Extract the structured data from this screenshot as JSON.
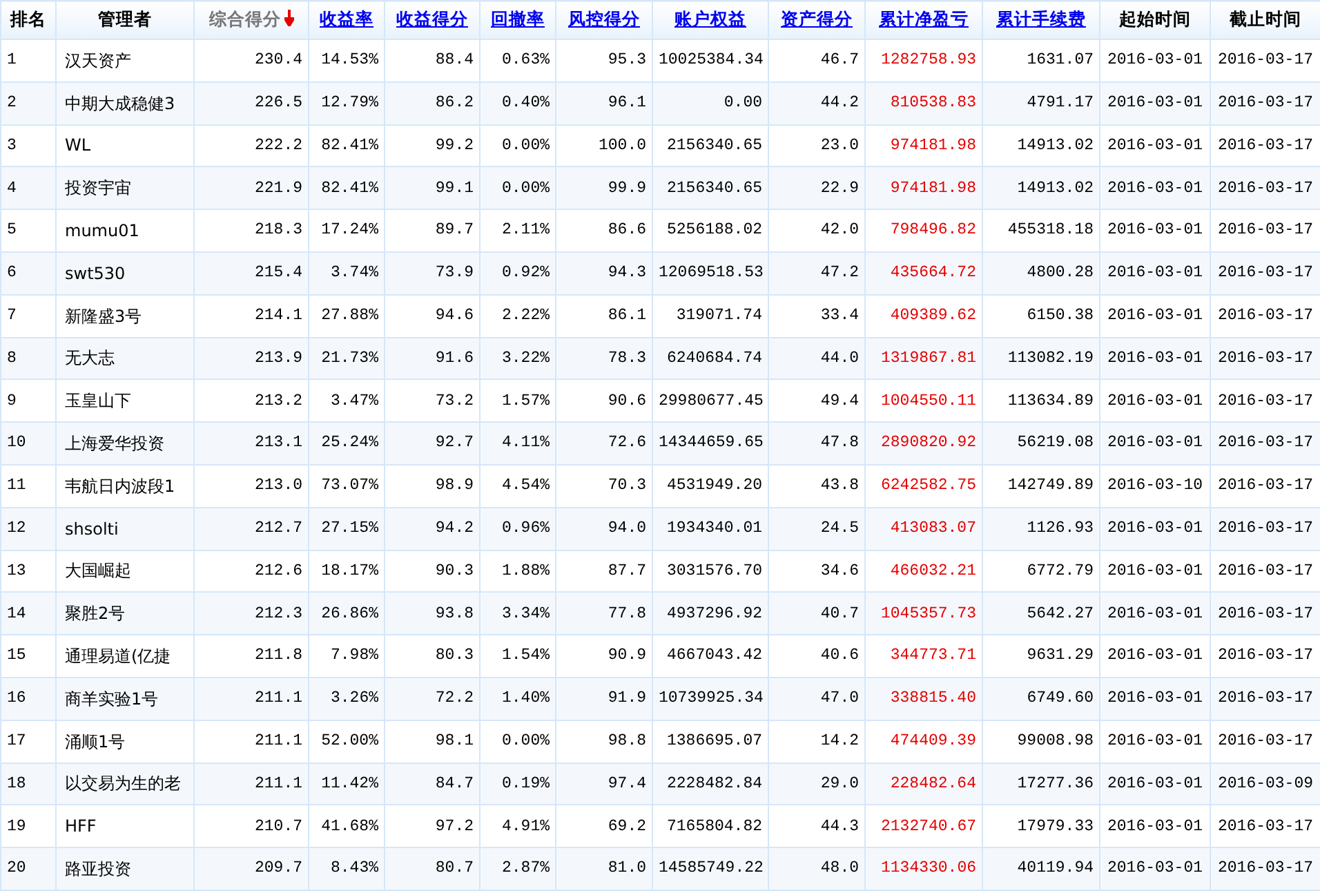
{
  "table": {
    "columns": [
      {
        "label": "排名",
        "kind": "rank",
        "link": false,
        "selected": false
      },
      {
        "label": "管理者",
        "kind": "name",
        "link": false,
        "selected": false
      },
      {
        "label": "综合得分",
        "kind": "number",
        "link": true,
        "selected": true
      },
      {
        "label": "收益率",
        "kind": "number",
        "link": true,
        "selected": false
      },
      {
        "label": "收益得分",
        "kind": "number",
        "link": true,
        "selected": false
      },
      {
        "label": "回撤率",
        "kind": "number",
        "link": true,
        "selected": false
      },
      {
        "label": "风控得分",
        "kind": "number",
        "link": true,
        "selected": false
      },
      {
        "label": "账户权益",
        "kind": "number",
        "link": true,
        "selected": false
      },
      {
        "label": "资产得分",
        "kind": "number",
        "link": true,
        "selected": false
      },
      {
        "label": "累计净盈亏",
        "kind": "profit",
        "link": true,
        "selected": false
      },
      {
        "label": "累计手续费",
        "kind": "number",
        "link": true,
        "selected": false
      },
      {
        "label": "起始时间",
        "kind": "date",
        "link": false,
        "selected": false
      },
      {
        "label": "截止时间",
        "kind": "date",
        "link": false,
        "selected": false
      }
    ],
    "rows": [
      [
        "1",
        "汉天资产",
        "230.4",
        "14.53%",
        "88.4",
        "0.63%",
        "95.3",
        "10025384.34",
        "46.7",
        "1282758.93",
        "1631.07",
        "2016-03-01",
        "2016-03-17"
      ],
      [
        "2",
        "中期大成稳健3",
        "226.5",
        "12.79%",
        "86.2",
        "0.40%",
        "96.1",
        "0.00",
        "44.2",
        "810538.83",
        "4791.17",
        "2016-03-01",
        "2016-03-17"
      ],
      [
        "3",
        "WL",
        "222.2",
        "82.41%",
        "99.2",
        "0.00%",
        "100.0",
        "2156340.65",
        "23.0",
        "974181.98",
        "14913.02",
        "2016-03-01",
        "2016-03-17"
      ],
      [
        "4",
        "投资宇宙",
        "221.9",
        "82.41%",
        "99.1",
        "0.00%",
        "99.9",
        "2156340.65",
        "22.9",
        "974181.98",
        "14913.02",
        "2016-03-01",
        "2016-03-17"
      ],
      [
        "5",
        "mumu01",
        "218.3",
        "17.24%",
        "89.7",
        "2.11%",
        "86.6",
        "5256188.02",
        "42.0",
        "798496.82",
        "455318.18",
        "2016-03-01",
        "2016-03-17"
      ],
      [
        "6",
        "swt530",
        "215.4",
        "3.74%",
        "73.9",
        "0.92%",
        "94.3",
        "12069518.53",
        "47.2",
        "435664.72",
        "4800.28",
        "2016-03-01",
        "2016-03-17"
      ],
      [
        "7",
        "新隆盛3号",
        "214.1",
        "27.88%",
        "94.6",
        "2.22%",
        "86.1",
        "319071.74",
        "33.4",
        "409389.62",
        "6150.38",
        "2016-03-01",
        "2016-03-17"
      ],
      [
        "8",
        "无大志",
        "213.9",
        "21.73%",
        "91.6",
        "3.22%",
        "78.3",
        "6240684.74",
        "44.0",
        "1319867.81",
        "113082.19",
        "2016-03-01",
        "2016-03-17"
      ],
      [
        "9",
        "玉皇山下",
        "213.2",
        "3.47%",
        "73.2",
        "1.57%",
        "90.6",
        "29980677.45",
        "49.4",
        "1004550.11",
        "113634.89",
        "2016-03-01",
        "2016-03-17"
      ],
      [
        "10",
        "上海爱华投资",
        "213.1",
        "25.24%",
        "92.7",
        "4.11%",
        "72.6",
        "14344659.65",
        "47.8",
        "2890820.92",
        "56219.08",
        "2016-03-01",
        "2016-03-17"
      ],
      [
        "11",
        "韦航日内波段1",
        "213.0",
        "73.07%",
        "98.9",
        "4.54%",
        "70.3",
        "4531949.20",
        "43.8",
        "6242582.75",
        "142749.89",
        "2016-03-10",
        "2016-03-17"
      ],
      [
        "12",
        "shsolti",
        "212.7",
        "27.15%",
        "94.2",
        "0.96%",
        "94.0",
        "1934340.01",
        "24.5",
        "413083.07",
        "1126.93",
        "2016-03-01",
        "2016-03-17"
      ],
      [
        "13",
        "大国崛起",
        "212.6",
        "18.17%",
        "90.3",
        "1.88%",
        "87.7",
        "3031576.70",
        "34.6",
        "466032.21",
        "6772.79",
        "2016-03-01",
        "2016-03-17"
      ],
      [
        "14",
        "聚胜2号",
        "212.3",
        "26.86%",
        "93.8",
        "3.34%",
        "77.8",
        "4937296.92",
        "40.7",
        "1045357.73",
        "5642.27",
        "2016-03-01",
        "2016-03-17"
      ],
      [
        "15",
        "通理易道(亿捷",
        "211.8",
        "7.98%",
        "80.3",
        "1.54%",
        "90.9",
        "4667043.42",
        "40.6",
        "344773.71",
        "9631.29",
        "2016-03-01",
        "2016-03-17"
      ],
      [
        "16",
        "商羊实验1号",
        "211.1",
        "3.26%",
        "72.2",
        "1.40%",
        "91.9",
        "10739925.34",
        "47.0",
        "338815.40",
        "6749.60",
        "2016-03-01",
        "2016-03-17"
      ],
      [
        "17",
        "涌顺1号",
        "211.1",
        "52.00%",
        "98.1",
        "0.00%",
        "98.8",
        "1386695.07",
        "14.2",
        "474409.39",
        "99008.98",
        "2016-03-01",
        "2016-03-17"
      ],
      [
        "18",
        "以交易为生的老",
        "211.1",
        "11.42%",
        "84.7",
        "0.19%",
        "97.4",
        "2228482.84",
        "29.0",
        "228482.64",
        "17277.36",
        "2016-03-01",
        "2016-03-09"
      ],
      [
        "19",
        "HFF",
        "210.7",
        "41.68%",
        "97.2",
        "4.91%",
        "69.2",
        "7165804.82",
        "44.3",
        "2132740.67",
        "17979.33",
        "2016-03-01",
        "2016-03-17"
      ],
      [
        "20",
        "路亚投资",
        "209.7",
        "8.43%",
        "80.7",
        "2.87%",
        "81.0",
        "14585749.22",
        "48.0",
        "1134330.06",
        "40119.94",
        "2016-03-01",
        "2016-03-17"
      ]
    ]
  }
}
